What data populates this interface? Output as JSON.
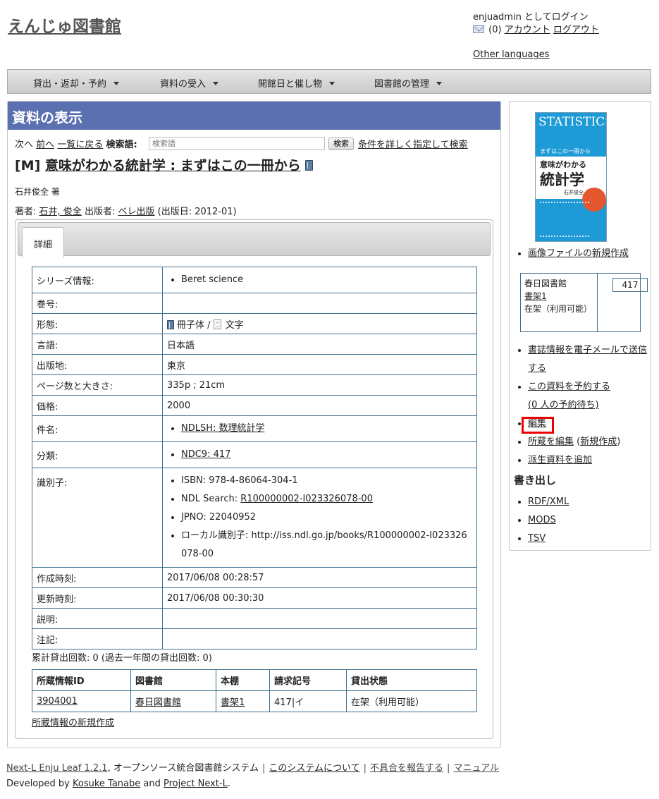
{
  "header": {
    "site_title": "えんじゅ図書館",
    "login_text": "enjuadmin としてログイン",
    "message_count": "(0)",
    "account_link": "アカウント",
    "logout_link": "ログアウト",
    "other_languages": "Other languages"
  },
  "menu": {
    "items": [
      "貸出・返却・予約",
      "資料の受入",
      "開館日と催し物",
      "図書館の管理"
    ]
  },
  "main": {
    "page_heading": "資料の表示",
    "nav": {
      "next": "次へ",
      "prev": "前へ",
      "back_to_list": "一覧に戻る",
      "search_label": "検索語:",
      "search_placeholder": "検索語",
      "search_button": "検索",
      "advanced_search": "条件を詳しく指定して検索"
    },
    "title_prefix": "[M]",
    "title": "意味がわかる統計学 : まずはこの一冊から",
    "author_line": "石井俊全 著",
    "pub": {
      "author_label": "著者:",
      "author": "石井, 俊全",
      "publisher_label": "出版者:",
      "publisher": "ベレ出版",
      "date": "(出版日: 2012-01)"
    },
    "tab_label": "詳細",
    "details": {
      "series_label": "シリーズ情報:",
      "series": "Beret science",
      "volume_label": "巻号:",
      "volume": "",
      "form_label": "形態:",
      "form_carrier": "冊子体 /",
      "form_content": "文字",
      "language_label": "言語:",
      "language": "日本語",
      "place_label": "出版地:",
      "place": "東京",
      "pages_label": "ページ数と大きさ:",
      "pages": "335p ; 21cm",
      "price_label": "価格:",
      "price": "2000",
      "subject_label": "件名:",
      "subject": "NDLSH: 数理統計学",
      "classification_label": "分類:",
      "classification": "NDC9: 417",
      "identifier_label": "識別子:",
      "isbn": "ISBN: 978-4-86064-304-1",
      "ndl_search_label": "NDL Search:",
      "ndl_search": "R100000002-I023326078-00",
      "jpno": "JPNO: 22040952",
      "local_id": "ローカル識別子: http://iss.ndl.go.jp/books/R100000002-I023326078-00",
      "created_label": "作成時刻:",
      "created": "2017/06/08 00:28:57",
      "updated_label": "更新時刻:",
      "updated": "2017/06/08 00:30:30",
      "description_label": "説明:",
      "description": "",
      "note_label": "注記:",
      "note": ""
    },
    "loan_count": "累計貸出回数: 0 (過去一年間の貸出回数: 0)",
    "holdings": {
      "headers": [
        "所蔵情報ID",
        "図書館",
        "本棚",
        "請求記号",
        "貸出状態"
      ],
      "rows": [
        [
          "3904001",
          "春日図書館",
          "書架1",
          "417|イ",
          "在架（利用可能）"
        ]
      ]
    },
    "new_holding": "所蔵情報の新規作成"
  },
  "sidebar": {
    "cover": {
      "series": "STATISTICS",
      "subtitle": "まずはこの一冊から",
      "title_top": "意味がわかる",
      "title_big": "統計学",
      "author": "石井俊全"
    },
    "new_image": "画像ファイルの新規作成",
    "holding_library": "春日図書館",
    "holding_shelf": "書架1",
    "holding_status": "在架（利用可能）",
    "holding_callno": "417",
    "actions": {
      "email": "書誌情報を電子メールで送信する",
      "reserve": "この資料を予約する",
      "reserve_count": "(0 人の予約待ち)",
      "edit": "編集",
      "edit_items": "所蔵を編集",
      "new_item": "新規作成",
      "add_derivative": "派生資料を追加"
    },
    "export_heading": "書き出し",
    "exports": [
      "RDF/XML",
      "MODS",
      "TSV"
    ]
  },
  "footer": {
    "product": "Next-L Enju Leaf 1.2.1",
    "tagline": ", オープンソース統合図書館システム",
    "about": "このシステムについて",
    "report": "不具合を報告する",
    "manual": "マニュアル",
    "developed_by": "Developed by",
    "dev1": "Kosuke Tanabe",
    "and": "and",
    "dev2": "Project Next-L",
    "period": "."
  },
  "colors": {
    "heading_bg": "#5b70b1",
    "table_border": "#3f6f8f",
    "highlight": "#ee0000"
  }
}
